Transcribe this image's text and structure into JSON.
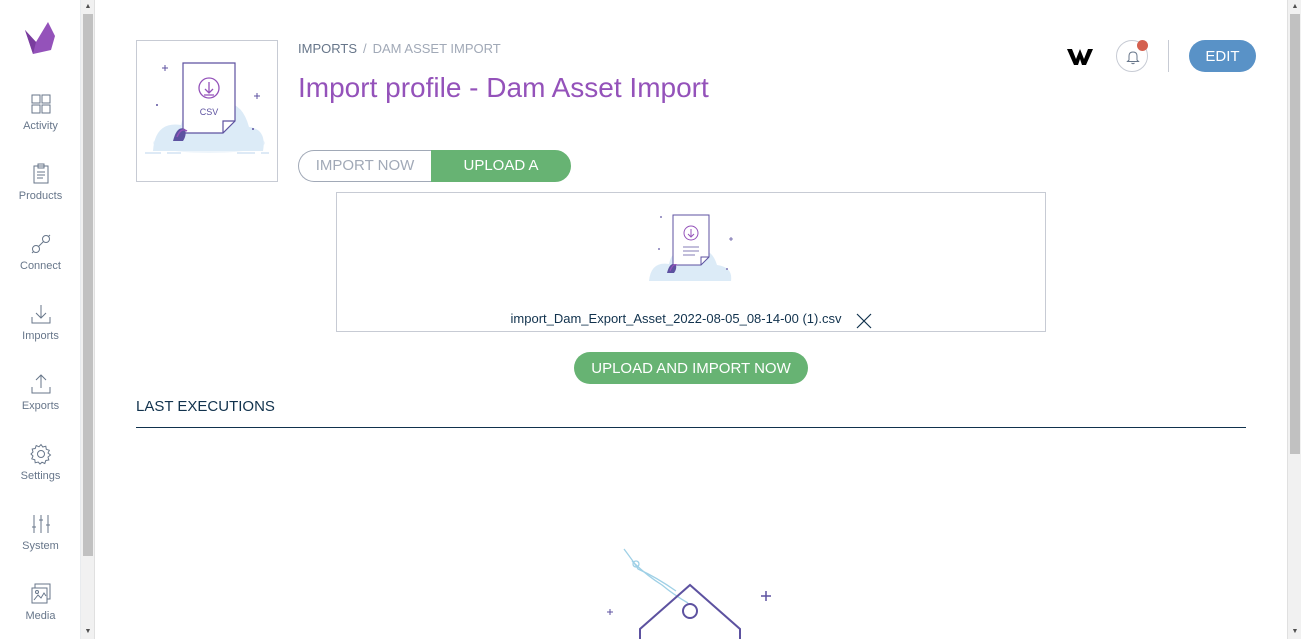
{
  "nav": {
    "items": [
      {
        "label": "Activity",
        "icon": "activity-icon"
      },
      {
        "label": "Products",
        "icon": "products-icon"
      },
      {
        "label": "Connect",
        "icon": "connect-icon"
      },
      {
        "label": "Imports",
        "icon": "imports-icon"
      },
      {
        "label": "Exports",
        "icon": "exports-icon"
      },
      {
        "label": "Settings",
        "icon": "settings-icon"
      },
      {
        "label": "System",
        "icon": "system-icon"
      },
      {
        "label": "Media",
        "icon": "media-icon"
      }
    ]
  },
  "breadcrumb": {
    "parent": "IMPORTS",
    "separator": "/",
    "current": "DAM ASSET IMPORT"
  },
  "header": {
    "title": "Import profile - Dam Asset Import",
    "thumb_label": "CSV",
    "edit_label": "EDIT"
  },
  "switcher": {
    "import_now": "IMPORT NOW",
    "upload_file": "UPLOAD A FILE"
  },
  "upload": {
    "file_name": "import_Dam_Export_Asset_2022-08-05_08-14-00 (1).csv",
    "button": "UPLOAD AND IMPORT NOW"
  },
  "executions": {
    "title": "LAST EXECUTIONS"
  },
  "colors": {
    "accent": "#9452ba",
    "primary": "#5992c7",
    "success": "#67b373",
    "notification": "#d4604f"
  }
}
